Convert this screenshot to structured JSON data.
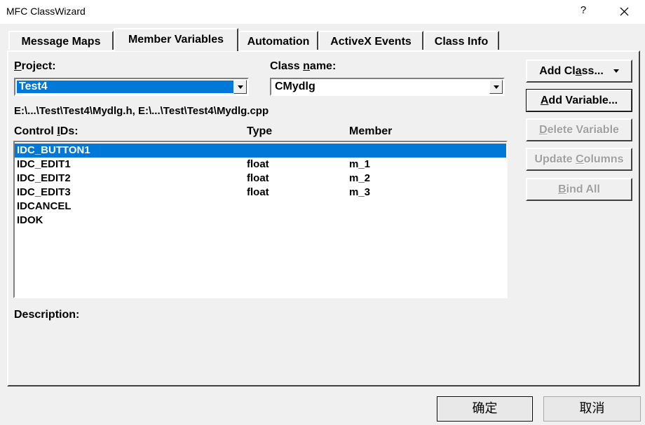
{
  "window": {
    "title": "MFC ClassWizard",
    "help": "?"
  },
  "tabs": [
    {
      "label": "Message Maps"
    },
    {
      "label": "Member Variables"
    },
    {
      "label": "Automation"
    },
    {
      "label": "ActiveX Events"
    },
    {
      "label": "Class Info"
    }
  ],
  "active_tab": "Member Variables",
  "project": {
    "label_ul": "P",
    "label_rest": "roject:",
    "value": "Test4"
  },
  "class_name": {
    "label_pre": "Class ",
    "label_ul": "n",
    "label_rest": "ame:",
    "value": "CMydlg"
  },
  "file_paths": "E:\\...\\Test\\Test4\\Mydlg.h, E:\\...\\Test\\Test4\\Mydlg.cpp",
  "list": {
    "headers": {
      "id_pre": "Control ",
      "id_ul": "I",
      "id_rest": "Ds:",
      "type": "Type",
      "member": "Member"
    },
    "rows": [
      {
        "id": "IDC_BUTTON1",
        "type": "",
        "member": ""
      },
      {
        "id": "IDC_EDIT1",
        "type": "float",
        "member": "m_1"
      },
      {
        "id": "IDC_EDIT2",
        "type": "float",
        "member": "m_2"
      },
      {
        "id": "IDC_EDIT3",
        "type": "float",
        "member": "m_3"
      },
      {
        "id": "IDCANCEL",
        "type": "",
        "member": ""
      },
      {
        "id": "IDOK",
        "type": "",
        "member": ""
      }
    ],
    "selected_index": 0
  },
  "description_label": "Description:",
  "buttons": {
    "add_class": {
      "pre": "Add Cl",
      "ul": "a",
      "rest": "ss..."
    },
    "add_variable": {
      "pre": "",
      "ul": "A",
      "rest": "dd Variable..."
    },
    "delete_variable": {
      "pre": "",
      "ul": "D",
      "rest": "elete Variable"
    },
    "update_columns": {
      "pre": "Update ",
      "ul": "C",
      "rest": "olumns"
    },
    "bind_all": {
      "pre": "",
      "ul": "B",
      "rest": "ind All"
    }
  },
  "footer": {
    "ok": "确定",
    "cancel": "取消"
  },
  "colors": {
    "selection": "#0078d7",
    "face": "#f0f0f0",
    "disabled_text": "#a0a0a0"
  }
}
